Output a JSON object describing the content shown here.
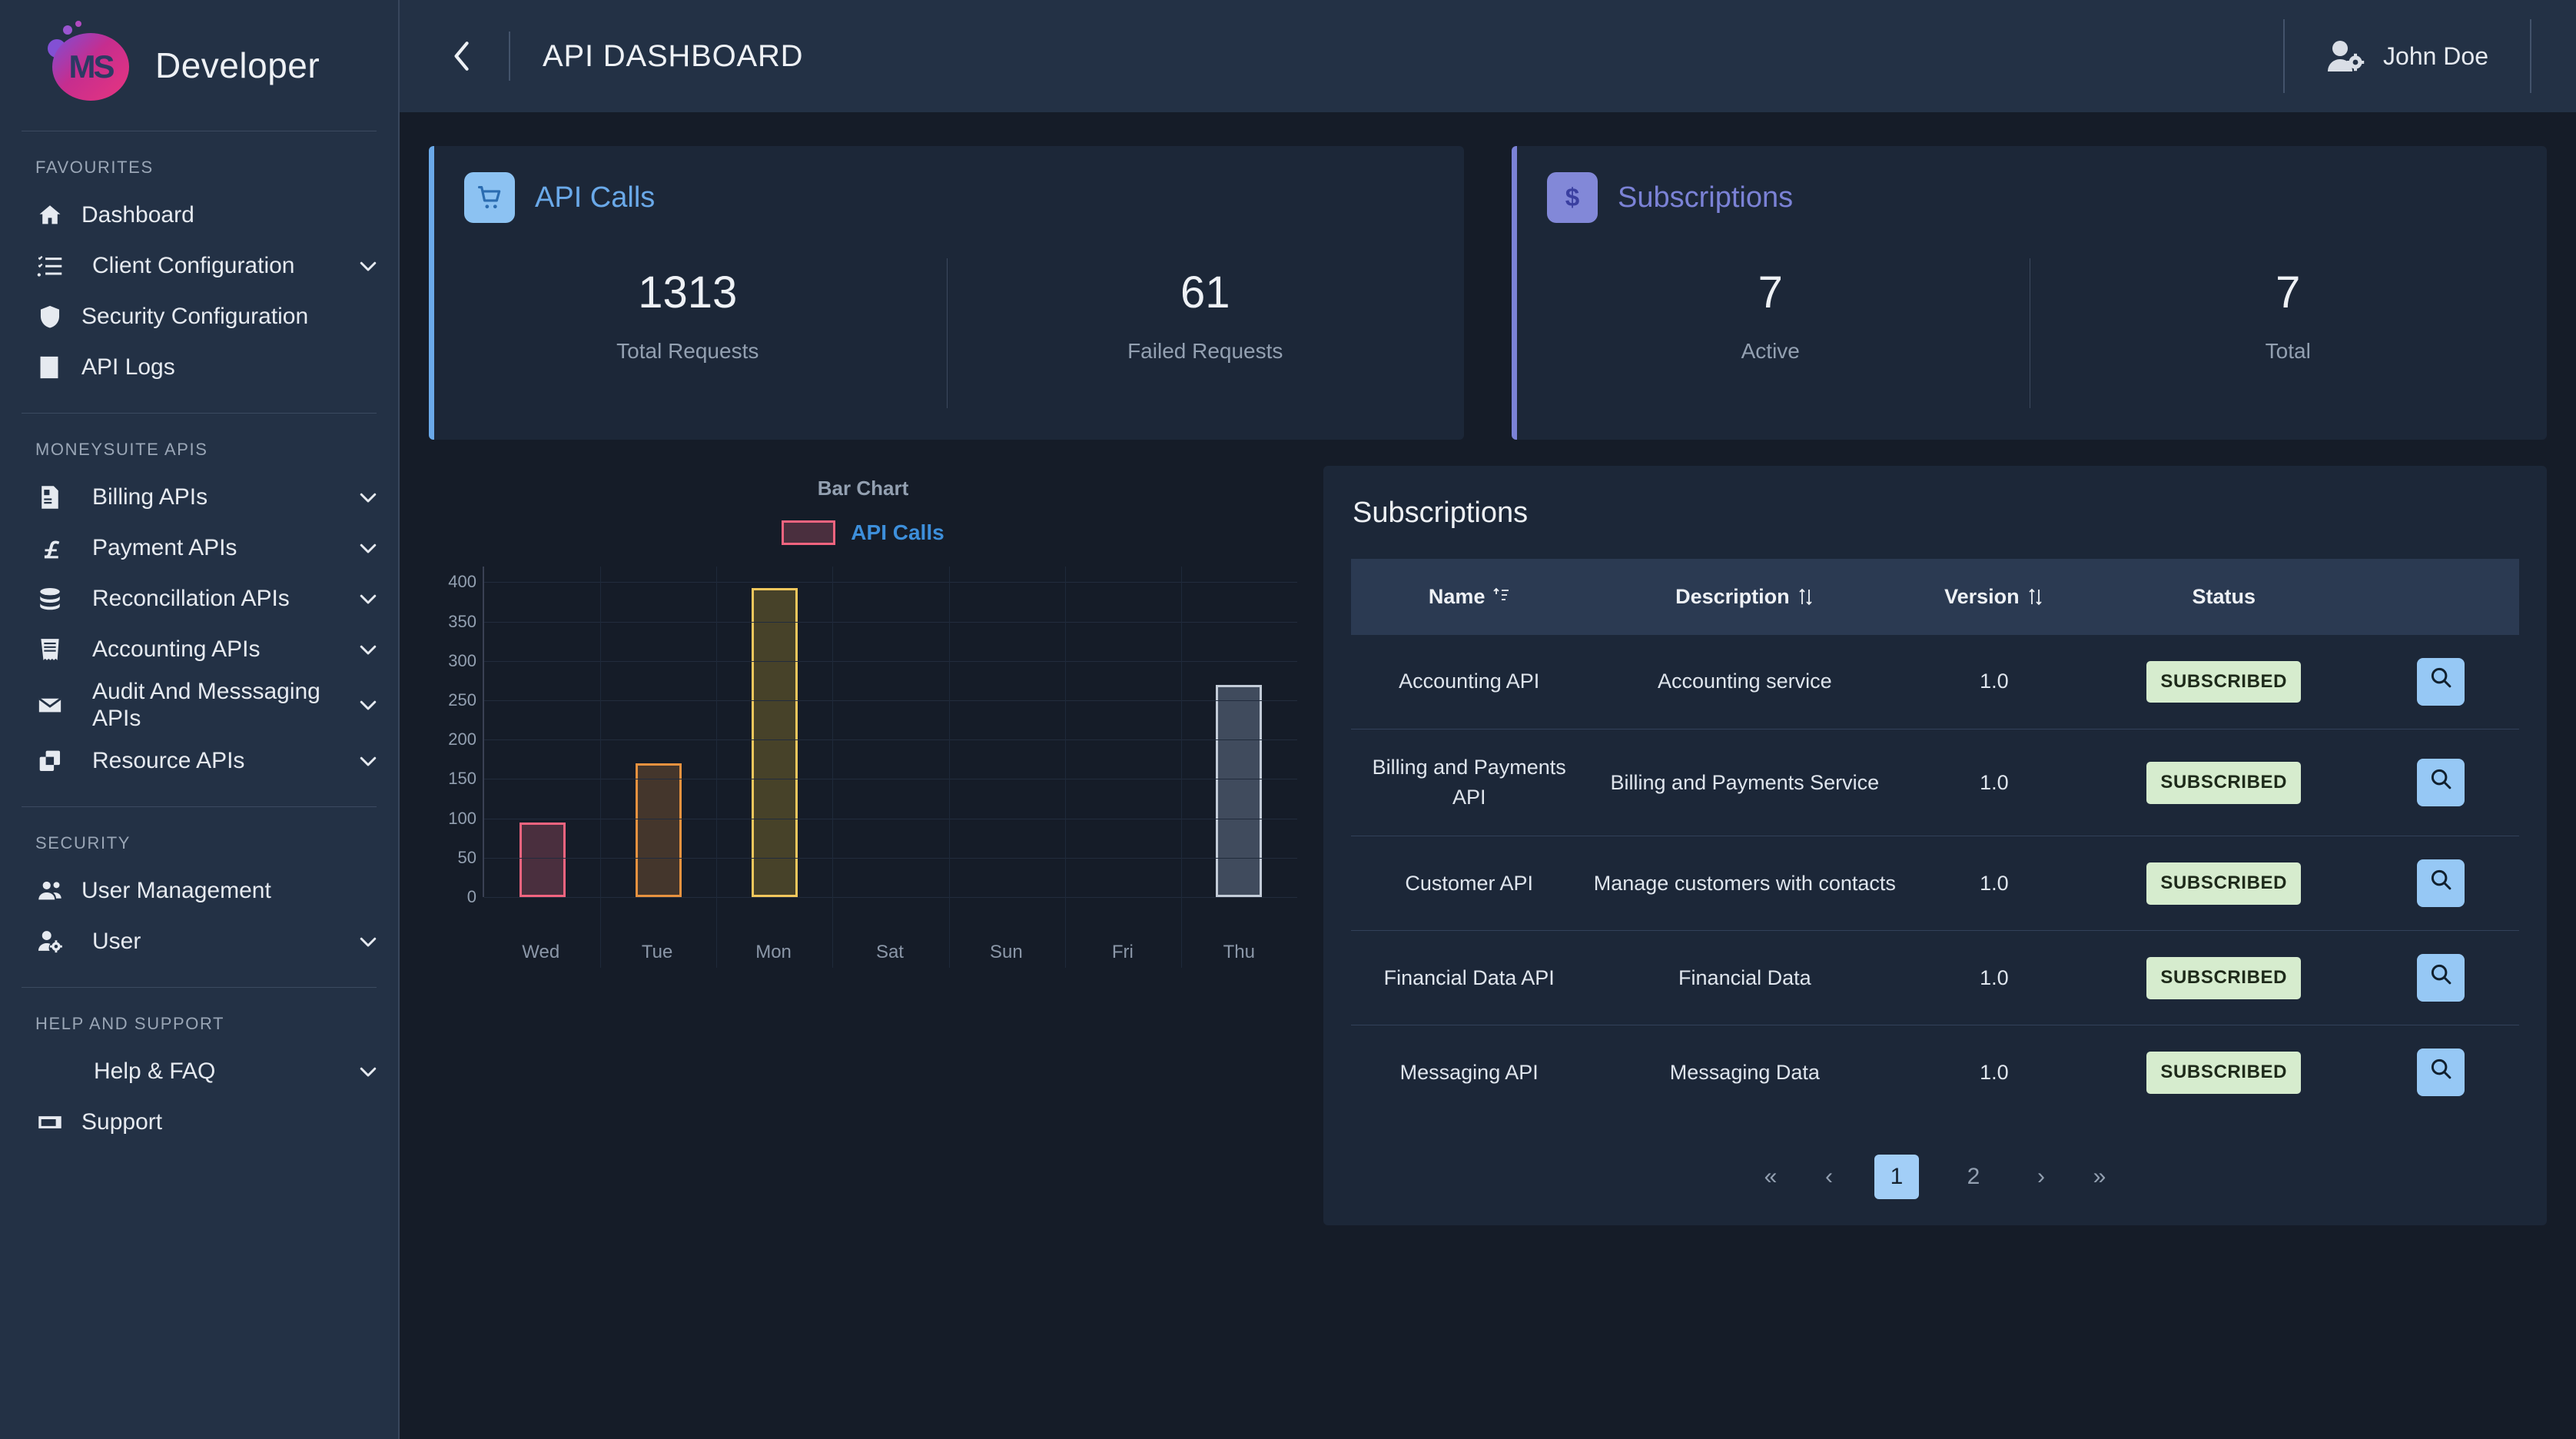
{
  "brand": {
    "name": "Developer",
    "logo_text": "MS"
  },
  "sidebar": {
    "sections": [
      {
        "title": "FAVOURITES",
        "items": [
          {
            "label": "Dashboard",
            "icon": "home-icon",
            "chevron": false
          },
          {
            "label": "Client Configuration",
            "icon": "checklist-icon",
            "chevron": true
          },
          {
            "label": "Security Configuration",
            "icon": "shield-icon",
            "chevron": false
          },
          {
            "label": "API Logs",
            "icon": "book-icon",
            "chevron": false
          }
        ]
      },
      {
        "title": "MONEYSUITE APIS",
        "items": [
          {
            "label": "Billing APIs",
            "icon": "invoice-icon",
            "chevron": true
          },
          {
            "label": "Payment APIs",
            "icon": "pound-icon",
            "chevron": true
          },
          {
            "label": "Reconcillation APIs",
            "icon": "database-icon",
            "chevron": true
          },
          {
            "label": "Accounting APIs",
            "icon": "receipt-icon",
            "chevron": true
          },
          {
            "label": "Audit And Messsaging APIs",
            "icon": "envelope-icon",
            "chevron": true
          },
          {
            "label": "Resource APIs",
            "icon": "windows-icon",
            "chevron": true
          }
        ]
      },
      {
        "title": "SECURITY",
        "items": [
          {
            "label": "User Management",
            "icon": "users-icon",
            "chevron": false
          },
          {
            "label": "User",
            "icon": "user-gear-icon",
            "chevron": true
          }
        ]
      },
      {
        "title": "HELP AND SUPPORT",
        "items": [
          {
            "label": "Help & FAQ",
            "icon": "none",
            "chevron": true
          },
          {
            "label": "Support",
            "icon": "ticket-icon",
            "chevron": false
          }
        ]
      }
    ]
  },
  "topbar": {
    "back_icon": "chevron-left-icon",
    "title": "API DASHBOARD",
    "user_name": "John Doe",
    "user_icon": "user-gear-icon"
  },
  "stats": [
    {
      "title": "API Calls",
      "icon": "cart-icon",
      "accent": "#6aa9e9",
      "icon_bg": "#8cc2f2",
      "title_color": "#6aa9e9",
      "metrics": [
        {
          "value": "1313",
          "label": "Total Requests"
        },
        {
          "value": "61",
          "label": "Failed Requests"
        }
      ]
    },
    {
      "title": "Subscriptions",
      "icon": "dollar-icon",
      "accent": "#7b82d6",
      "icon_bg": "#8288d8",
      "title_color": "#7b82d6",
      "metrics": [
        {
          "value": "7",
          "label": "Active"
        },
        {
          "value": "7",
          "label": "Total"
        }
      ]
    }
  ],
  "chart_data": {
    "type": "bar",
    "title": "Bar Chart",
    "legend": [
      {
        "name": "API Calls",
        "color": "#f2647f"
      }
    ],
    "legend_position": "top-center",
    "categories": [
      "Wed",
      "Tue",
      "Mon",
      "Sat",
      "Sun",
      "Fri",
      "Thu"
    ],
    "values": [
      95,
      170,
      393,
      0,
      0,
      0,
      270
    ],
    "bar_colors": [
      "#f2647f",
      "#e8923f",
      "#f2c75c",
      "#3a4154",
      "#3a4154",
      "#3a4154",
      "#c3ccd8"
    ],
    "bar_fills": [
      "#4a2f3e",
      "#44362c",
      "#474229",
      "#2a3547",
      "#2a3547",
      "#2a3547",
      "#404b5d"
    ],
    "xlabel": "",
    "ylabel": "",
    "ylim": [
      0,
      420
    ],
    "yticks": [
      0,
      50,
      100,
      150,
      200,
      250,
      300,
      350,
      400
    ],
    "grid": true
  },
  "subscriptions": {
    "heading": "Subscriptions",
    "columns": [
      {
        "label": "Name",
        "sort": "az-icon"
      },
      {
        "label": "Description",
        "sort": "updown-icon"
      },
      {
        "label": "Version",
        "sort": "updown-icon"
      },
      {
        "label": "Status",
        "sort": "none"
      },
      {
        "label": "",
        "sort": "none"
      }
    ],
    "rows": [
      {
        "name": "Accounting API",
        "description": "Accounting service",
        "version": "1.0",
        "status": "SUBSCRIBED",
        "action": "search-icon"
      },
      {
        "name": "Billing and Payments API",
        "description": "Billing and Payments Service",
        "version": "1.0",
        "status": "SUBSCRIBED",
        "action": "search-icon"
      },
      {
        "name": "Customer API",
        "description": "Manage customers with contacts",
        "version": "1.0",
        "status": "SUBSCRIBED",
        "action": "search-icon"
      },
      {
        "name": "Financial Data API",
        "description": "Financial Data",
        "version": "1.0",
        "status": "SUBSCRIBED",
        "action": "search-icon"
      },
      {
        "name": "Messaging API",
        "description": "Messaging Data",
        "version": "1.0",
        "status": "SUBSCRIBED",
        "action": "search-icon"
      }
    ],
    "pagination": {
      "first": "«",
      "prev": "‹",
      "pages": [
        "1",
        "2"
      ],
      "active_page": "1",
      "next": "›",
      "last": "»"
    }
  }
}
